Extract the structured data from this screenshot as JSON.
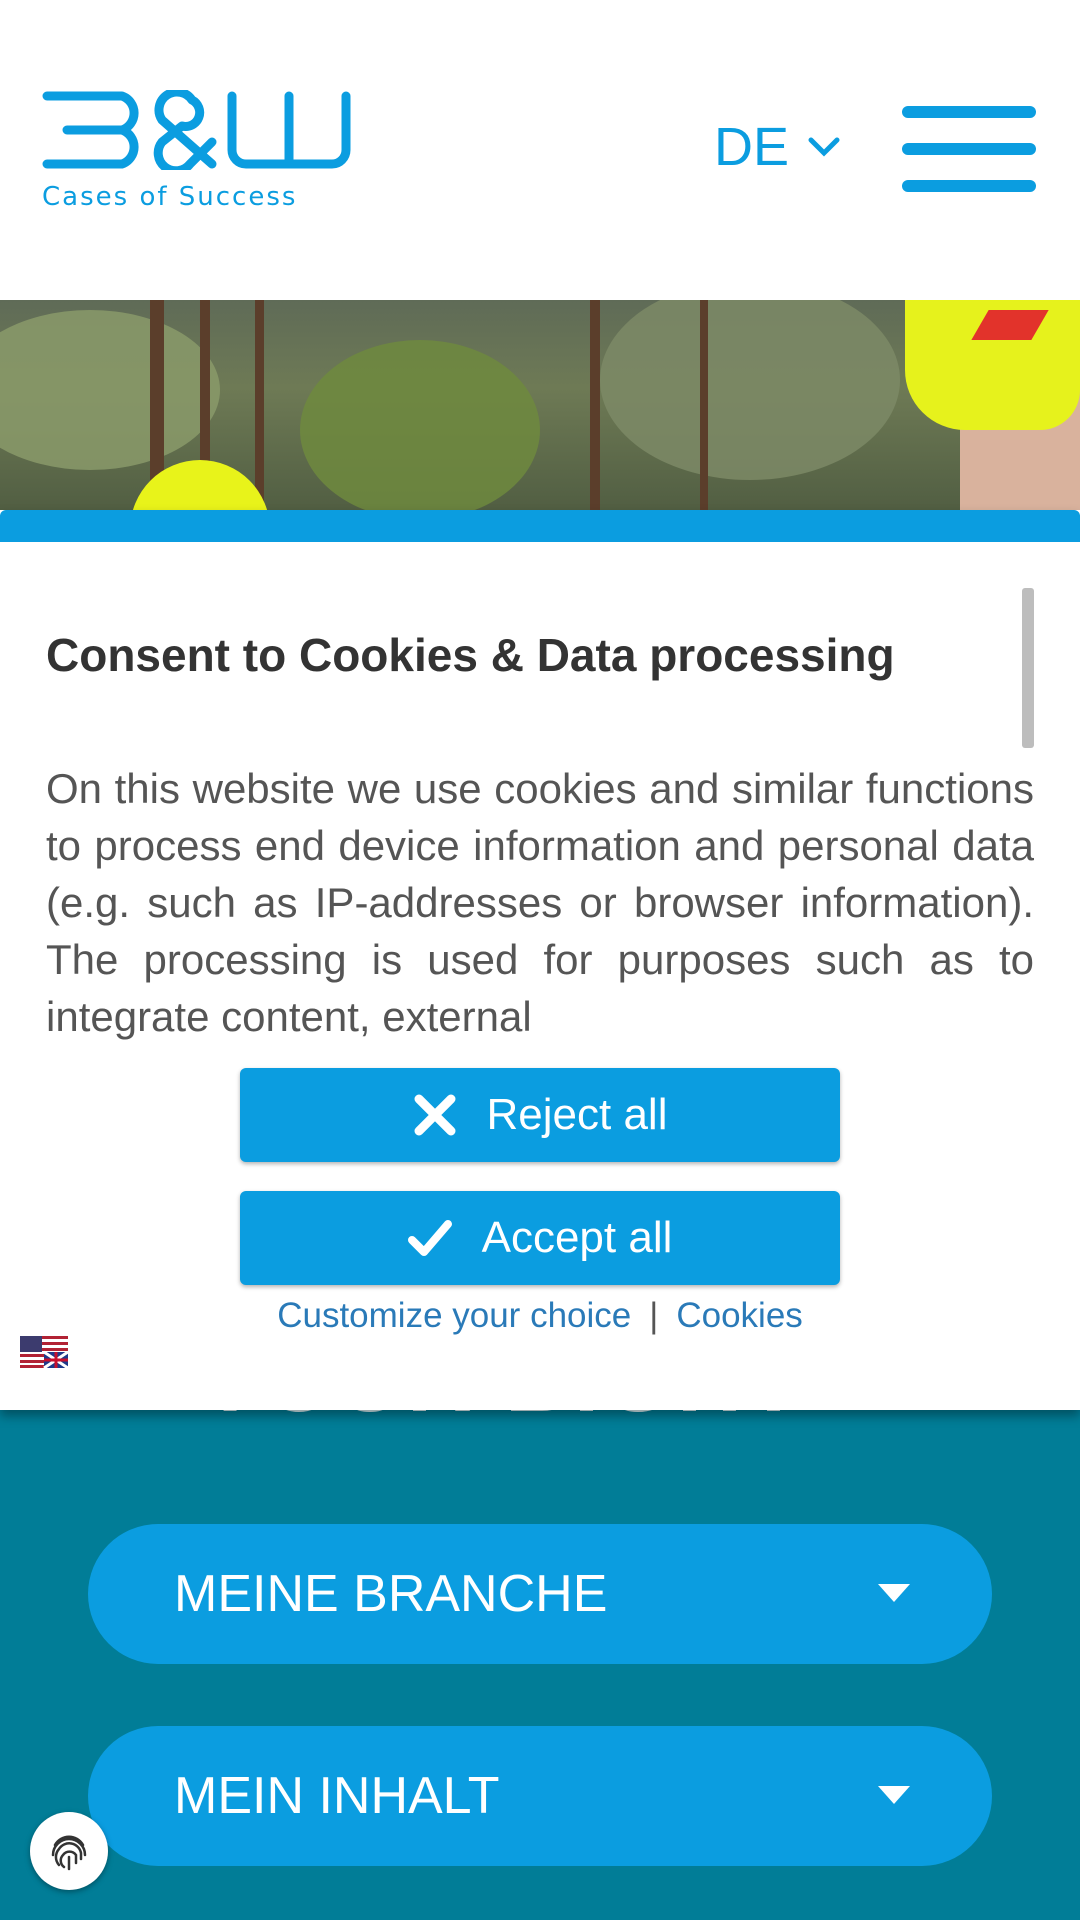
{
  "header": {
    "logo_text": "B&W",
    "logo_tagline": "Cases of Success",
    "language": "DE",
    "menu_icon": "hamburger-menu-icon"
  },
  "page": {
    "ghost_heading": "YOUR BIGHT",
    "dropdowns": [
      {
        "label": "MEINE BRANCHE",
        "icon": "caret-down-icon"
      },
      {
        "label": "MEIN INHALT",
        "icon": "caret-down-icon"
      }
    ],
    "fingerprint_icon": "fingerprint-icon"
  },
  "consent": {
    "title": "Consent to Cookies & Data processing",
    "body": "On this website we use cookies and similar functions to process end device information and personal data (e.g. such as IP-addresses or browser information). The processing is used for purposes such as to integrate content, external",
    "reject_label": "Reject all",
    "accept_label": "Accept all",
    "customize_label": "Customize your choice",
    "separator": "|",
    "cookies_label": "Cookies",
    "flag_icon": "us-uk-flag-icon"
  },
  "colors": {
    "brand_blue": "#0b9de0",
    "teal_background": "#017d97",
    "link_blue": "#2a7ab8"
  }
}
